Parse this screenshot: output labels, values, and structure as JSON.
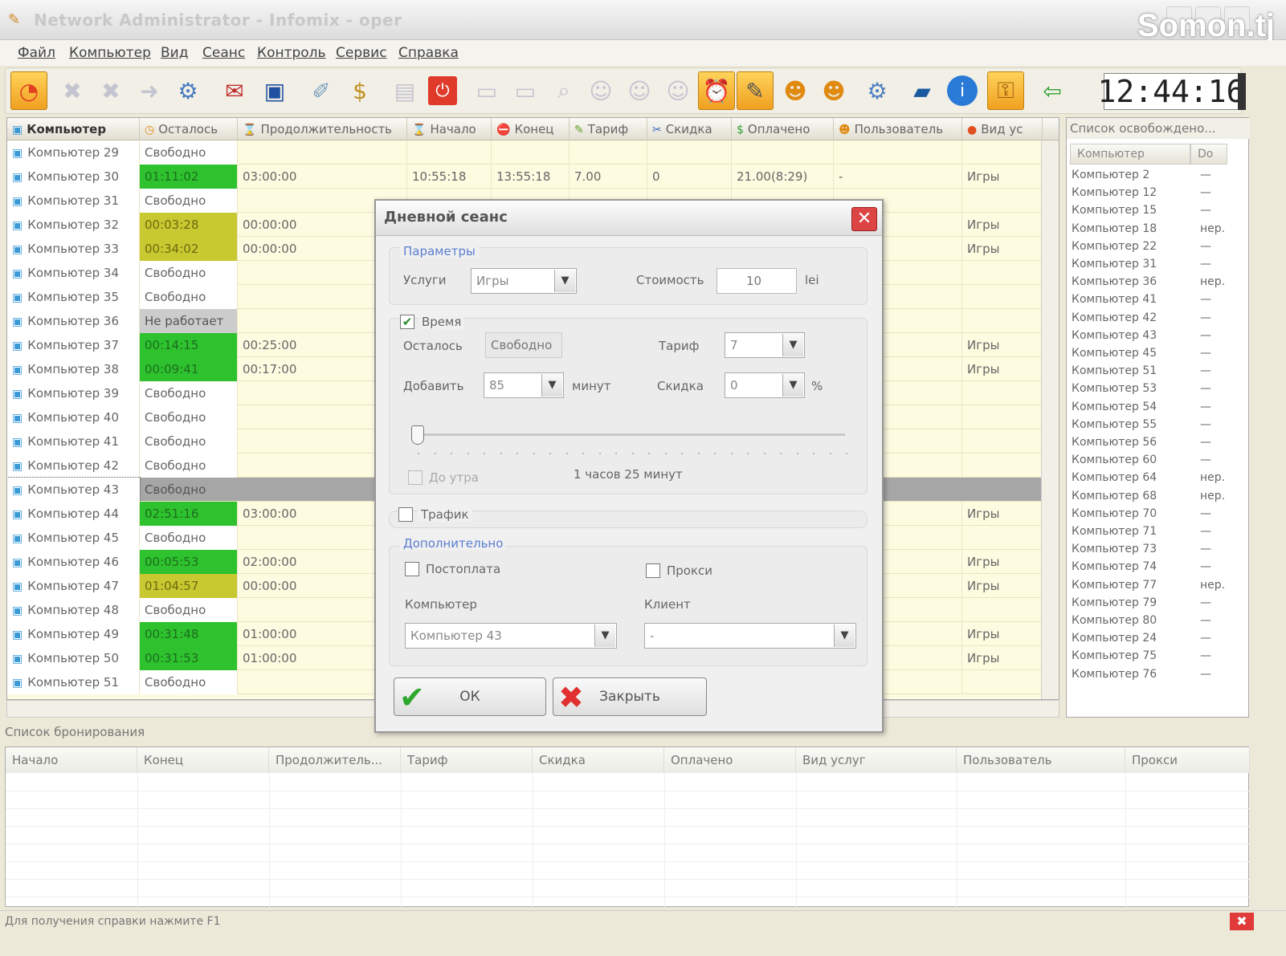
{
  "window": {
    "title": "Network Administrator - Infomix - oper",
    "watermark": "Somon.tj"
  },
  "menu": [
    "Файл",
    "Компьютер",
    "Вид",
    "Сеанс",
    "Контроль",
    "Сервис",
    "Справка"
  ],
  "toolbar": {
    "clock": "12:44:16"
  },
  "grid": {
    "columns": [
      "Компьютер",
      "Осталось",
      "Продолжительность",
      "Начало",
      "Конец",
      "Тариф",
      "Скидка",
      "Оплачено",
      "Пользователь",
      "Вид ус"
    ],
    "rows": [
      {
        "name": "Компьютер 29",
        "left": "Свободно",
        "duration": "",
        "start": "",
        "end": "",
        "tariff": "",
        "discount": "",
        "paid": "",
        "user": "",
        "service": "",
        "status": "free"
      },
      {
        "name": "Компьютер 30",
        "left": "01:11:02",
        "duration": "03:00:00",
        "start": "10:55:18",
        "end": "13:55:18",
        "tariff": "7.00",
        "discount": "0",
        "paid": "21.00(8:29)",
        "user": "-",
        "service": "Игры",
        "status": "green"
      },
      {
        "name": "Компьютер 31",
        "left": "Свободно",
        "duration": "",
        "start": "",
        "end": "",
        "tariff": "",
        "discount": "",
        "paid": "",
        "user": "",
        "service": "",
        "status": "free"
      },
      {
        "name": "Компьютер 32",
        "left": "00:03:28",
        "duration": "00:00:00",
        "start": "",
        "end": "",
        "tariff": "",
        "discount": "",
        "paid": "",
        "user": "",
        "service": "Игры",
        "status": "yellow"
      },
      {
        "name": "Компьютер 33",
        "left": "00:34:02",
        "duration": "00:00:00",
        "start": "",
        "end": "",
        "tariff": "",
        "discount": "",
        "paid": "",
        "user": "",
        "service": "Игры",
        "status": "yellow"
      },
      {
        "name": "Компьютер 34",
        "left": "Свободно",
        "duration": "",
        "start": "",
        "end": "",
        "tariff": "",
        "discount": "",
        "paid": "",
        "user": "",
        "service": "",
        "status": "free"
      },
      {
        "name": "Компьютер 35",
        "left": "Свободно",
        "duration": "",
        "start": "",
        "end": "",
        "tariff": "",
        "discount": "",
        "paid": "",
        "user": "",
        "service": "",
        "status": "free"
      },
      {
        "name": "Компьютер 36",
        "left": "Не работает",
        "duration": "",
        "start": "",
        "end": "",
        "tariff": "",
        "discount": "",
        "paid": "",
        "user": "",
        "service": "",
        "status": "gray"
      },
      {
        "name": "Компьютер 37",
        "left": "00:14:15",
        "duration": "00:25:00",
        "start": "",
        "end": "",
        "tariff": "",
        "discount": "",
        "paid": "",
        "user": "",
        "service": "Игры",
        "status": "green"
      },
      {
        "name": "Компьютер 38",
        "left": "00:09:41",
        "duration": "00:17:00",
        "start": "",
        "end": "",
        "tariff": "",
        "discount": "",
        "paid": "",
        "user": "",
        "service": "Игры",
        "status": "green"
      },
      {
        "name": "Компьютер 39",
        "left": "Свободно",
        "duration": "",
        "start": "",
        "end": "",
        "tariff": "",
        "discount": "",
        "paid": "",
        "user": "",
        "service": "",
        "status": "free"
      },
      {
        "name": "Компьютер 40",
        "left": "Свободно",
        "duration": "",
        "start": "",
        "end": "",
        "tariff": "",
        "discount": "",
        "paid": "",
        "user": "",
        "service": "",
        "status": "free"
      },
      {
        "name": "Компьютер 41",
        "left": "Свободно",
        "duration": "",
        "start": "",
        "end": "",
        "tariff": "",
        "discount": "",
        "paid": "",
        "user": "",
        "service": "",
        "status": "free"
      },
      {
        "name": "Компьютер 42",
        "left": "Свободно",
        "duration": "",
        "start": "",
        "end": "",
        "tariff": "",
        "discount": "",
        "paid": "",
        "user": "",
        "service": "",
        "status": "free"
      },
      {
        "name": "Компьютер 43",
        "left": "Свободно",
        "duration": "",
        "start": "",
        "end": "",
        "tariff": "",
        "discount": "",
        "paid": "",
        "user": "",
        "service": "",
        "status": "selected"
      },
      {
        "name": "Компьютер 44",
        "left": "02:51:16",
        "duration": "03:00:00",
        "start": "",
        "end": "",
        "tariff": "",
        "discount": "",
        "paid": "",
        "user": "",
        "service": "Игры",
        "status": "green"
      },
      {
        "name": "Компьютер 45",
        "left": "Свободно",
        "duration": "",
        "start": "",
        "end": "",
        "tariff": "",
        "discount": "",
        "paid": "",
        "user": "",
        "service": "",
        "status": "free"
      },
      {
        "name": "Компьютер 46",
        "left": "00:05:53",
        "duration": "02:00:00",
        "start": "",
        "end": "",
        "tariff": "",
        "discount": "",
        "paid": "",
        "user": "",
        "service": "Игры",
        "status": "green"
      },
      {
        "name": "Компьютер 47",
        "left": "01:04:57",
        "duration": "00:00:00",
        "start": "",
        "end": "",
        "tariff": "",
        "discount": "",
        "paid": "",
        "user": "",
        "service": "Игры",
        "status": "yellow"
      },
      {
        "name": "Компьютер 48",
        "left": "Свободно",
        "duration": "",
        "start": "",
        "end": "",
        "tariff": "",
        "discount": "",
        "paid": "",
        "user": "",
        "service": "",
        "status": "free"
      },
      {
        "name": "Компьютер 49",
        "left": "00:31:48",
        "duration": "01:00:00",
        "start": "",
        "end": "",
        "tariff": "",
        "discount": "",
        "paid": "",
        "user": "",
        "service": "Игры",
        "status": "green"
      },
      {
        "name": "Компьютер 50",
        "left": "00:31:53",
        "duration": "01:00:00",
        "start": "",
        "end": "",
        "tariff": "",
        "discount": "",
        "paid": "",
        "user": "",
        "service": "Игры",
        "status": "green"
      },
      {
        "name": "Компьютер 51",
        "left": "Свободно",
        "duration": "",
        "start": "",
        "end": "",
        "tariff": "",
        "discount": "",
        "paid": "",
        "user": "",
        "service": "",
        "status": "free"
      }
    ]
  },
  "free_list": {
    "title": "Список освобождено...",
    "columns": [
      "Компьютер",
      "Do"
    ],
    "rows": [
      {
        "name": "Компьютер 2",
        "d": "—"
      },
      {
        "name": "Компьютер 12",
        "d": "—"
      },
      {
        "name": "Компьютер 15",
        "d": "—"
      },
      {
        "name": "Компьютер 18",
        "d": "нер."
      },
      {
        "name": "Компьютер 22",
        "d": "—"
      },
      {
        "name": "Компьютер 31",
        "d": "—"
      },
      {
        "name": "Компьютер 36",
        "d": "нер."
      },
      {
        "name": "Компьютер 41",
        "d": "—"
      },
      {
        "name": "Компьютер 42",
        "d": "—"
      },
      {
        "name": "Компьютер 43",
        "d": "—"
      },
      {
        "name": "Компьютер 45",
        "d": "—"
      },
      {
        "name": "Компьютер 51",
        "d": "—"
      },
      {
        "name": "Компьютер 53",
        "d": "—"
      },
      {
        "name": "Компьютер 54",
        "d": "—"
      },
      {
        "name": "Компьютер 55",
        "d": "—"
      },
      {
        "name": "Компьютер 56",
        "d": "—"
      },
      {
        "name": "Компьютер 60",
        "d": "—"
      },
      {
        "name": "Компьютер 64",
        "d": "нер."
      },
      {
        "name": "Компьютер 68",
        "d": "нер."
      },
      {
        "name": "Компьютер 70",
        "d": "—"
      },
      {
        "name": "Компьютер 71",
        "d": "—"
      },
      {
        "name": "Компьютер 73",
        "d": "—"
      },
      {
        "name": "Компьютер 74",
        "d": "—"
      },
      {
        "name": "Компьютер 77",
        "d": "нер."
      },
      {
        "name": "Компьютер 79",
        "d": "—"
      },
      {
        "name": "Компьютер 80",
        "d": "—"
      },
      {
        "name": "Компьютер 24",
        "d": "—"
      },
      {
        "name": "Компьютер 75",
        "d": "—"
      },
      {
        "name": "Компьютер 76",
        "d": "—"
      }
    ]
  },
  "booking": {
    "title": "Список бронирования",
    "columns": [
      "Начало",
      "Конец",
      "Продолжитель...",
      "Тариф",
      "Скидка",
      "Оплачено",
      "Вид услуг",
      "Пользователь",
      "Прокси"
    ]
  },
  "status_bar": "Для получения справки нажмите F1",
  "dialog": {
    "title": "Дневной сеанс",
    "params_label": "Параметры",
    "services_label": "Услуги",
    "services_value": "Игры",
    "cost_label": "Стоимость",
    "cost_value": "10",
    "cost_unit": "lei",
    "time_label": "Время",
    "time_checked": true,
    "left_label": "Осталось",
    "left_value": "Свободно",
    "tariff_label": "Тариф",
    "tariff_value": "7",
    "add_label": "Добавить",
    "add_value": "85",
    "add_unit": "минут",
    "discount_label": "Скидка",
    "discount_value": "0",
    "discount_unit": "%",
    "until_exit_label": "До утра",
    "slider_text": "1 часов 25 минут",
    "traffic_label": "Трафик",
    "extra_label": "Дополнительно",
    "postpay_label": "Постоплата",
    "proxy_label": "Прокси",
    "computer_label": "Компьютер",
    "computer_value": "Компьютер 43",
    "client_label": "Клиент",
    "client_value": "-",
    "ok_label": "ОК",
    "close_label": "Закрыть"
  },
  "colors": {
    "busy": "#2ec22e",
    "warning": "#c8c830",
    "selected": "#a6a6a6",
    "grid_bg": "#fdfbe0"
  }
}
